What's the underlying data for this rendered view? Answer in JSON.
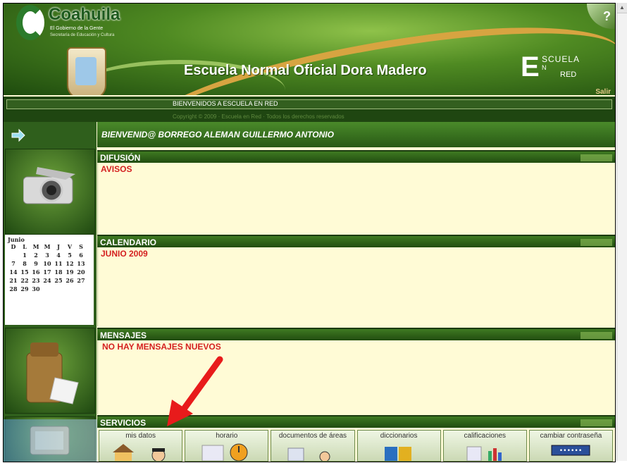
{
  "banner": {
    "logo_title": "Coahuila",
    "logo_subtitle": "El Gobierno de la Gente",
    "logo_subtitle2": "Secretaría de Educación y Cultura",
    "school_name": "Escuela Normal Oficial Dora Madero",
    "enr_logo": {
      "big": "E",
      "t1": "SCUELA",
      "t2": "N",
      "t3": "RED"
    },
    "help_label": "?",
    "salir": "Salir"
  },
  "welcome_bar": {
    "text": "BIENVENIDOS A ESCUELA EN RED",
    "copyright": "Copyright © 2009 · Escuela en Red · Todos los derechos reservados"
  },
  "greeting": "BIENVENID@ BORREGO ALEMAN GUILLERMO ANTONIO",
  "sections": {
    "difusion": {
      "header": "DIFUSIÓN",
      "title": "AVISOS"
    },
    "calendario": {
      "header": "CALENDARIO",
      "title": "JUNIO 2009"
    },
    "mensajes": {
      "header": "MENSAJES",
      "title": "NO HAY MENSAJES NUEVOS"
    },
    "servicios": {
      "header": "SERVICIOS"
    }
  },
  "calendar": {
    "month": "Junio",
    "days_header": [
      "D",
      "L",
      "M",
      "M",
      "J",
      "V",
      "S"
    ],
    "days": [
      "",
      "1",
      "2",
      "3",
      "4",
      "5",
      "6",
      "7",
      "8",
      "9",
      "10",
      "11",
      "12",
      "13",
      "14",
      "15",
      "16",
      "17",
      "18",
      "19",
      "20",
      "21",
      "22",
      "23",
      "24",
      "25",
      "26",
      "27",
      "28",
      "29",
      "30"
    ]
  },
  "services": [
    {
      "label": "mis datos",
      "icon": "house-icon"
    },
    {
      "label": "horario",
      "icon": "clock-icon"
    },
    {
      "label": "documentos de áreas",
      "icon": "documents-icon"
    },
    {
      "label": "diccionarios",
      "icon": "books-icon"
    },
    {
      "label": "calificaciones",
      "icon": "grades-icon"
    },
    {
      "label": "cambiar contraseña",
      "icon": "password-icon"
    }
  ],
  "colors": {
    "accent_red": "#d42020",
    "header_green": "#2f5f1c",
    "panel_bg": "#fffbd6"
  }
}
